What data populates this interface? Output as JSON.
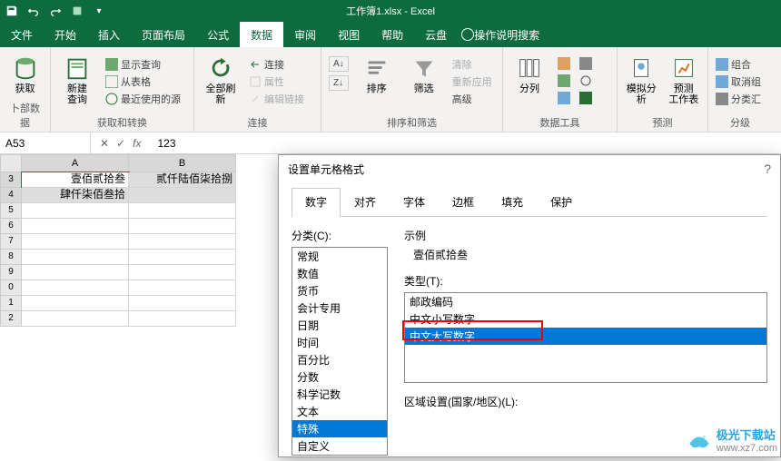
{
  "titlebar": {
    "filename": "工作簿1.xlsx",
    "app": "Excel"
  },
  "tabs": [
    "文件",
    "开始",
    "插入",
    "页面布局",
    "公式",
    "数据",
    "审阅",
    "视图",
    "帮助",
    "云盘"
  ],
  "activeTab": 5,
  "searchHint": "操作说明搜索",
  "ribbon": {
    "grp1": {
      "btn1": "获取\n   ",
      "btn1b": "卜部数据",
      "label": ""
    },
    "grp2": {
      "btn1": "新建\n查询",
      "s1": "显示查询",
      "s2": "从表格",
      "s3": "最近使用的源",
      "label": "获取和转换"
    },
    "grp3": {
      "btn1": "全部刷新",
      "s1": "连接",
      "s2": "属性",
      "s3": "编辑链接",
      "label": "连接"
    },
    "grp4": {
      "az": "A↓Z",
      "za": "Z↓A",
      "sort": "排序",
      "filter": "筛选",
      "s1": "清除",
      "s2": "重新应用",
      "s3": "高级",
      "label": "排序和筛选"
    },
    "grp5": {
      "btn1": "分列",
      "label": "数据工具"
    },
    "grp6": {
      "btn1": "模拟分析",
      "btn2": "预测\n工作表",
      "label": "预测"
    },
    "grp7": {
      "s1": "组合",
      "s2": "取消组",
      "s3": "分类汇",
      "label": "分级"
    }
  },
  "fbar": {
    "name": "A53",
    "fx": "fx",
    "value": "123"
  },
  "cols": [
    "A",
    "B"
  ],
  "rows": [
    "3",
    "4",
    "5",
    "6",
    "7",
    "8",
    "9",
    "0",
    "1",
    "2"
  ],
  "cells": {
    "A3": "壹佰贰拾叁",
    "B3": "贰仟陆佰柒拾捌",
    "A4": "肆仟柒佰叁拾"
  },
  "dialog": {
    "title": "设置单元格格式",
    "help": "?",
    "tabs": [
      "数字",
      "对齐",
      "字体",
      "边框",
      "填充",
      "保护"
    ],
    "activeTab": 0,
    "catLabel": "分类(C):",
    "cats": [
      "常规",
      "数值",
      "货币",
      "会计专用",
      "日期",
      "时间",
      "百分比",
      "分数",
      "科学记数",
      "文本",
      "特殊",
      "自定义"
    ],
    "catSel": 10,
    "sampleLabel": "示例",
    "sampleValue": "壹佰贰拾叁",
    "typeLabel": "类型(T):",
    "types": [
      "邮政编码",
      "中文小写数字",
      "中文大写数字"
    ],
    "typeSel": 2,
    "localeLabel": "区域设置(国家/地区)(L):"
  },
  "watermark": {
    "name": "极光下载站",
    "url": "www.xz7.com"
  },
  "chart_data": null
}
